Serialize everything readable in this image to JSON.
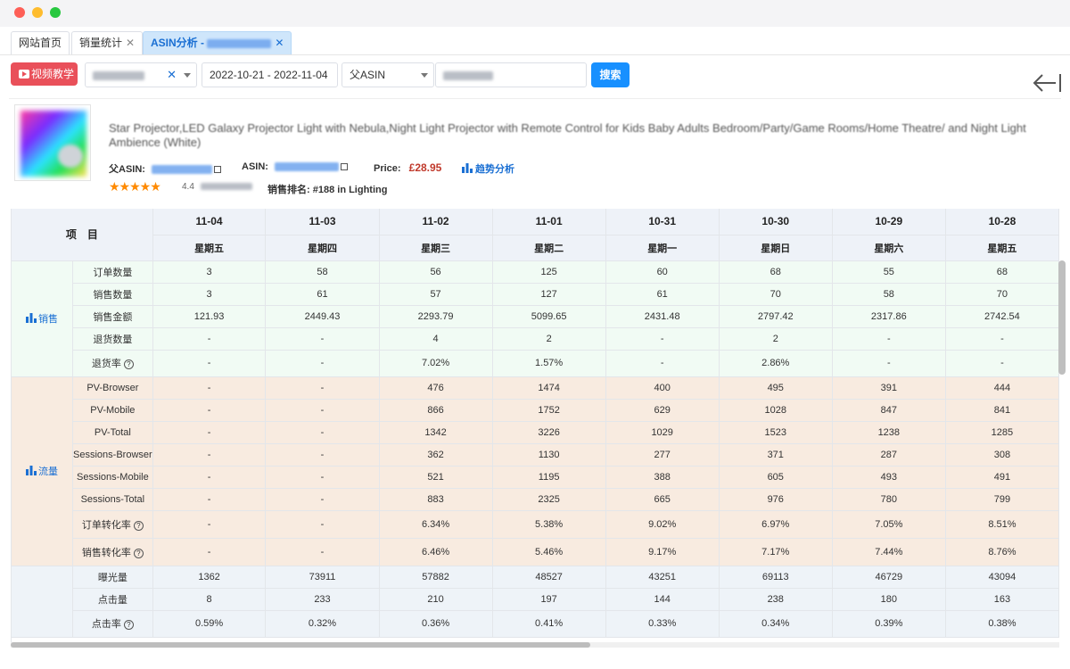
{
  "tabs": [
    {
      "label": "网站首页",
      "closable": false,
      "active": false
    },
    {
      "label": "销量统计",
      "closable": true,
      "active": false
    },
    {
      "label": "ASIN分析 - ",
      "closable": true,
      "active": true
    }
  ],
  "toolbar": {
    "video_label": "视频教学",
    "date_range": "2022-10-21 - 2022-11-04",
    "asin_type": "父ASIN",
    "search_label": "搜索"
  },
  "product": {
    "title": "Star Projector,LED Galaxy Projector Light with Nebula,Night Light Projector with Remote Control for Kids Baby Adults Bedroom/Party/Game Rooms/Home Theatre/ and Night Light Ambience (White)",
    "parent_asin_label": "父ASIN:",
    "asin_label": "ASIN:",
    "price_label": "Price:",
    "price": "£28.95",
    "trend_label": "趋势分析",
    "stars": "★★★★★",
    "rating": "4.4",
    "rank_label": "销售排名:",
    "rank": "#188 in Lighting"
  },
  "table": {
    "header_item": "项　目",
    "columns": [
      {
        "date": "11-04",
        "weekday": "星期五"
      },
      {
        "date": "11-03",
        "weekday": "星期四"
      },
      {
        "date": "11-02",
        "weekday": "星期三"
      },
      {
        "date": "11-01",
        "weekday": "星期二"
      },
      {
        "date": "10-31",
        "weekday": "星期一"
      },
      {
        "date": "10-30",
        "weekday": "星期日"
      },
      {
        "date": "10-29",
        "weekday": "星期六"
      },
      {
        "date": "10-28",
        "weekday": "星期五"
      }
    ],
    "groups": [
      {
        "label": "销售",
        "key": "sales",
        "rows": [
          {
            "label": "订单数量",
            "help": false,
            "values": [
              "3",
              "58",
              "56",
              "125",
              "60",
              "68",
              "55",
              "68"
            ]
          },
          {
            "label": "销售数量",
            "help": false,
            "values": [
              "3",
              "61",
              "57",
              "127",
              "61",
              "70",
              "58",
              "70"
            ]
          },
          {
            "label": "销售金额",
            "help": false,
            "values": [
              "121.93",
              "2449.43",
              "2293.79",
              "5099.65",
              "2431.48",
              "2797.42",
              "2317.86",
              "2742.54"
            ]
          },
          {
            "label": "退货数量",
            "help": false,
            "values": [
              "-",
              "-",
              "4",
              "2",
              "-",
              "2",
              "-",
              "-"
            ]
          },
          {
            "label": "退货率",
            "help": true,
            "values": [
              "-",
              "-",
              "7.02%",
              "1.57%",
              "-",
              "2.86%",
              "-",
              "-"
            ]
          }
        ]
      },
      {
        "label": "流量",
        "key": "traffic",
        "rows": [
          {
            "label": "PV-Browser",
            "help": false,
            "values": [
              "-",
              "-",
              "476",
              "1474",
              "400",
              "495",
              "391",
              "444"
            ]
          },
          {
            "label": "PV-Mobile",
            "help": false,
            "values": [
              "-",
              "-",
              "866",
              "1752",
              "629",
              "1028",
              "847",
              "841"
            ]
          },
          {
            "label": "PV-Total",
            "help": false,
            "values": [
              "-",
              "-",
              "1342",
              "3226",
              "1029",
              "1523",
              "1238",
              "1285"
            ]
          },
          {
            "label": "Sessions-Browser",
            "help": false,
            "values": [
              "-",
              "-",
              "362",
              "1130",
              "277",
              "371",
              "287",
              "308"
            ]
          },
          {
            "label": "Sessions-Mobile",
            "help": false,
            "values": [
              "-",
              "-",
              "521",
              "1195",
              "388",
              "605",
              "493",
              "491"
            ]
          },
          {
            "label": "Sessions-Total",
            "help": false,
            "values": [
              "-",
              "-",
              "883",
              "2325",
              "665",
              "976",
              "780",
              "799"
            ]
          },
          {
            "label": "订单转化率",
            "help": true,
            "values": [
              "-",
              "-",
              "6.34%",
              "5.38%",
              "9.02%",
              "6.97%",
              "7.05%",
              "8.51%"
            ]
          },
          {
            "label": "销售转化率",
            "help": true,
            "values": [
              "-",
              "-",
              "6.46%",
              "5.46%",
              "9.17%",
              "7.17%",
              "7.44%",
              "8.76%"
            ]
          }
        ]
      },
      {
        "label": "",
        "key": "ad",
        "rows": [
          {
            "label": "曝光量",
            "help": false,
            "values": [
              "1362",
              "73911",
              "57882",
              "48527",
              "43251",
              "69113",
              "46729",
              "43094"
            ]
          },
          {
            "label": "点击量",
            "help": false,
            "values": [
              "8",
              "233",
              "210",
              "197",
              "144",
              "238",
              "180",
              "163"
            ]
          },
          {
            "label": "点击率",
            "help": true,
            "values": [
              "0.59%",
              "0.32%",
              "0.36%",
              "0.41%",
              "0.33%",
              "0.34%",
              "0.39%",
              "0.38%"
            ]
          }
        ]
      }
    ]
  },
  "colors": {
    "accent": "#1890ff",
    "video": "#e9505a",
    "price": "#c0392b",
    "star": "#ff8a00"
  }
}
